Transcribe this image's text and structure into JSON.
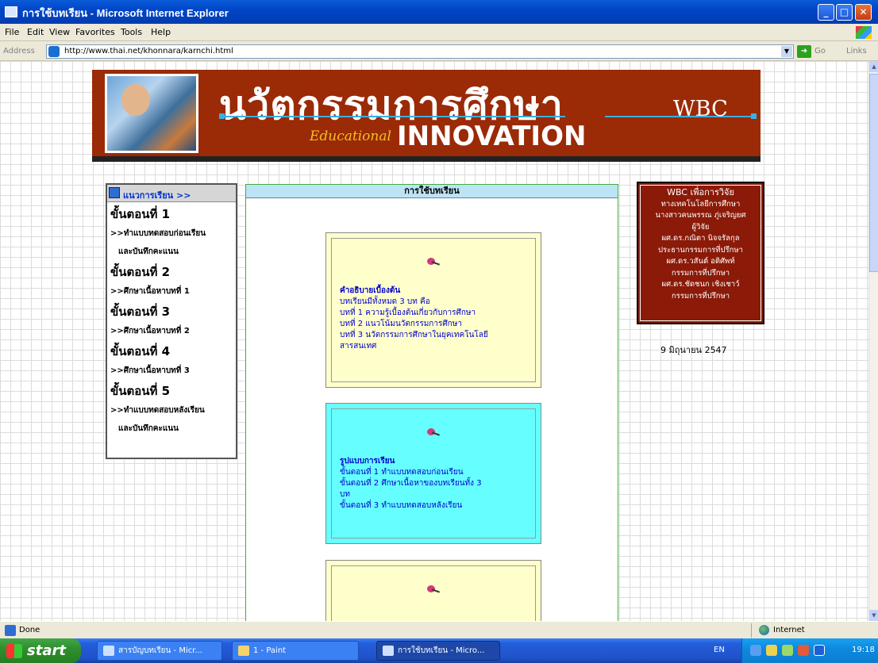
{
  "window": {
    "title": "การใช้บทเรียน - Microsoft Internet Explorer",
    "buttons": [
      "_",
      "□",
      "✕"
    ]
  },
  "menu": [
    "File",
    "Edit",
    "View",
    "Favorites",
    "Tools",
    "Help"
  ],
  "address": {
    "label": "Address",
    "url": "http://www.thai.net/khonnara/karnchi.html",
    "go_label": "Go",
    "links_label": "Links"
  },
  "banner": {
    "thai_title": "นวัตกรรมการศึกษา",
    "educational": "Educational",
    "innovation": "INNOVATION",
    "wbc": "WBC"
  },
  "leftnav": {
    "header": "แนวการเรียน >>",
    "items": [
      {
        "step": "ขั้นตอนที่ 1",
        "sub": [
          ">>ทำแบบทดสอบก่อนเรียน",
          "และบันทึกคะแนน"
        ]
      },
      {
        "step": "ขั้นตอนที่ 2",
        "sub": [
          ">>ศึกษาเนื้อหาบทที่ 1"
        ]
      },
      {
        "step": "ขั้นตอนที่ 3",
        "sub": [
          ">>ศึกษาเนื้อหาบทที่ 2"
        ]
      },
      {
        "step": "ขั้นตอนที่ 4",
        "sub": [
          ">>ศึกษาเนื้อหาบทที่ 3"
        ]
      },
      {
        "step": "ขั้นตอนที่ 5",
        "sub": [
          ">>ทำแบบทดสอบหลังเรียน",
          "และบันทึกคะแนน"
        ]
      }
    ]
  },
  "center": {
    "title": "การใช้บทเรียน",
    "cards": [
      {
        "heading": "คำอธิบายเบื้องต้น",
        "lines": [
          "บทเรียนมีทั้งหมด 3 บท คือ",
          "บทที่ 1 ความรู้เบื้องต้นเกี่ยวกับการศึกษา",
          "บทที่ 2 แนวโน้มนวัตกรรมการศึกษา",
          "บทที่ 3 นวัตกรรมการศึกษาในยุคเทคโนโลยี",
          "สารสนเทศ"
        ]
      },
      {
        "heading": "รูปแบบการเรียน",
        "lines": [
          "ขั้นตอนที่ 1 ทำแบบทดสอบก่อนเรียน",
          "ขั้นตอนที่ 2 ศึกษาเนื้อหาของบทเรียนทั้ง 3",
          "บท",
          "ขั้นตอนที่ 3 ทำแบบทดสอบหลังเรียน"
        ]
      },
      {
        "heading": "",
        "lines": []
      }
    ]
  },
  "info": {
    "lines": [
      "WBC เพื่อการวิจัย",
      "ทางเทคโนโลยีการศึกษา",
      "นางสาวคนพรรณ ภู่เจริญยศ",
      "ผู้วิจัย",
      "ผศ.ดร.กณิตา นิจจรัลกุล",
      "ประธานกรรมการที่ปรึกษา",
      "ผศ.ดร.วสันต์ อติศัพท์",
      "กรรมการที่ปรึกษา",
      "ผศ.ดร.ชัดชนก เชิงเชาว์",
      "กรรมการที่ปรึกษา"
    ],
    "date": "9 มิถุนายน 2547"
  },
  "status": {
    "text": "Done",
    "zone": "Internet"
  },
  "taskbar": {
    "start": "start",
    "tasks": [
      "สารบัญบทเรียน - Micr...",
      "1 - Paint",
      "การใช้บทเรียน - Micro..."
    ],
    "lang": "EN",
    "clock": "19:18"
  }
}
